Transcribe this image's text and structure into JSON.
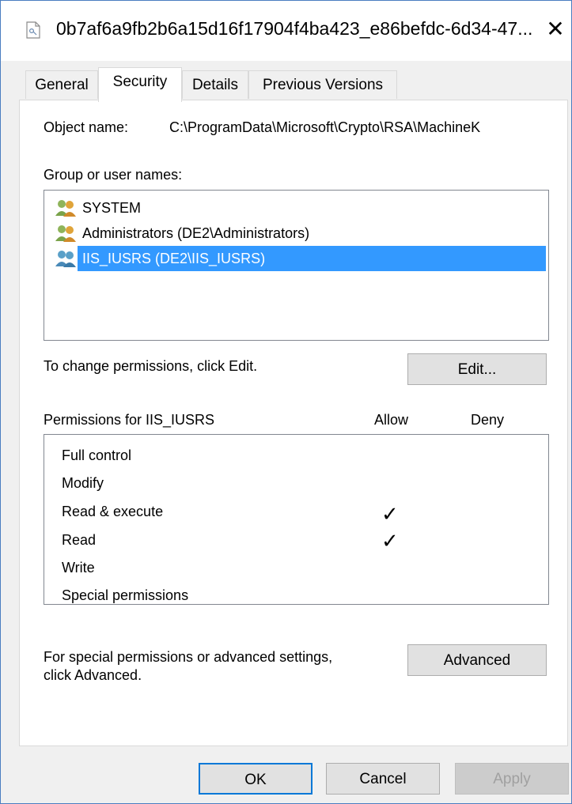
{
  "window": {
    "title": "0b7af6a9fb2b6a15d16f17904f4ba423_e86befdc-6d34-47...",
    "close_glyph": "✕"
  },
  "tabs": [
    "General",
    "Security",
    "Details",
    "Previous Versions"
  ],
  "object": {
    "label": "Object name:",
    "value": "C:\\ProgramData\\Microsoft\\Crypto\\RSA\\MachineK"
  },
  "groups": {
    "label": "Group or user names:",
    "items": [
      {
        "name": "SYSTEM",
        "icon": "users-icon"
      },
      {
        "name": "Administrators (DE2\\Administrators)",
        "icon": "users-icon"
      },
      {
        "name": "IIS_IUSRS (DE2\\IIS_IUSRS)",
        "icon": "users-icon",
        "selected": true
      }
    ]
  },
  "change_hint": "To change permissions, click Edit.",
  "edit_button": "Edit...",
  "permissions": {
    "header": "Permissions for IIS_IUSRS",
    "allow_col": "Allow",
    "deny_col": "Deny",
    "rows": [
      {
        "name": "Full control",
        "allow": false,
        "deny": false
      },
      {
        "name": "Modify",
        "allow": false,
        "deny": false
      },
      {
        "name": "Read & execute",
        "allow": true,
        "deny": false
      },
      {
        "name": "Read",
        "allow": true,
        "deny": false
      },
      {
        "name": "Write",
        "allow": false,
        "deny": false
      },
      {
        "name": "Special permissions",
        "allow": false,
        "deny": false
      }
    ],
    "check_glyph": "✓"
  },
  "advanced_hint": [
    "For special permissions or advanced settings,",
    "click Advanced."
  ],
  "advanced_button": "Advanced",
  "footer": {
    "ok": "OK",
    "cancel": "Cancel",
    "apply": "Apply"
  },
  "colors": {
    "selection": "#3399ff",
    "accent": "#0078d7",
    "window_border": "#4a7dc0"
  }
}
